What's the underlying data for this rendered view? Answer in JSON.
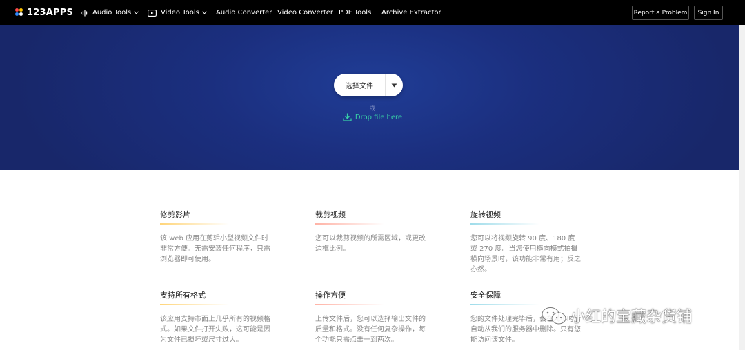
{
  "header": {
    "logo_text": "123APPS",
    "nav": [
      {
        "label": "Audio Tools",
        "icon": "audio-wave-icon",
        "has_dropdown": true
      },
      {
        "label": "Video Tools",
        "icon": "play-icon",
        "has_dropdown": true
      },
      {
        "label": "Audio Converter"
      },
      {
        "label": "Video Converter"
      },
      {
        "label": "PDF Tools"
      },
      {
        "label": "Archive Extractor"
      }
    ],
    "report_label": "Report a Problem",
    "signin_label": "Sign In"
  },
  "hero": {
    "choose_label": "选择文件",
    "or_label": "或",
    "drop_label": "Drop file here"
  },
  "features": [
    {
      "title": "修剪影片",
      "desc": "该 web 应用在剪辑小型视频文件时非常方便。无需安装任何程序，只需浏览器即可使用。",
      "accent": "#ffd57a"
    },
    {
      "title": "裁剪视频",
      "desc": "您可以裁剪视频的所需区域，或更改边框比例。",
      "accent": "#ffb3a6"
    },
    {
      "title": "旋转视频",
      "desc": "您可以将视频旋转 90 度、180 度或 270 度。当您使用横向模式拍摄横向场景时，该功能非常有用；反之亦然。",
      "accent": "#9fdcea"
    },
    {
      "title": "支持所有格式",
      "desc": "该应用支持市面上几乎所有的视频格式。如果文件打开失败，这可能是因为文件已损坏或尺寸过大。",
      "accent": "#ffd57a"
    },
    {
      "title": "操作方便",
      "desc": "上传文件后，您可以选择输出文件的质量和格式。没有任何复杂操作，每个功能只需点击一到两次。",
      "accent": "#ffb3a6"
    },
    {
      "title": "安全保障",
      "desc": "您的文件处理完毕后，会在几小时后自动从我们的服务器中删除。只有您能访问该文件。",
      "accent": "#9fdcea"
    }
  ],
  "watermark": {
    "text": "小红的宝藏杂货铺"
  },
  "colors": {
    "topbar": "#000000",
    "hero": "#1b2f7f",
    "drop": "#38d0a6"
  }
}
